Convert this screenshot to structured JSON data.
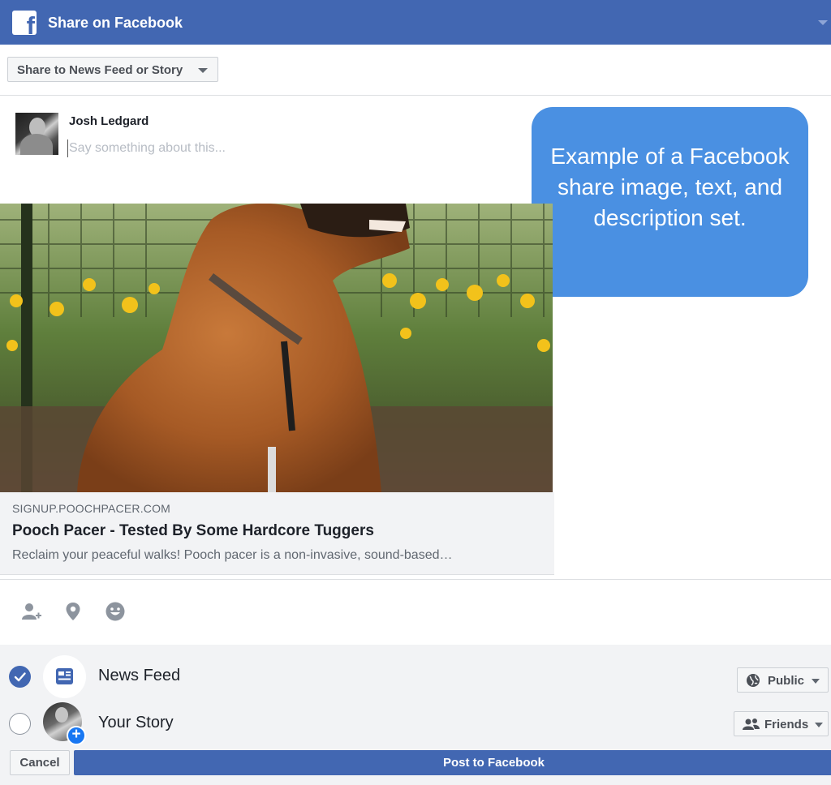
{
  "header": {
    "title": "Share on Facebook",
    "logo_icon": "facebook-f-icon",
    "menu_icon": "chevron-down-icon"
  },
  "share_target": {
    "label": "Share to News Feed or Story",
    "icon": "caret-down-icon"
  },
  "composer": {
    "user_name": "Josh Ledgard",
    "placeholder": "Say something about this...",
    "value": ""
  },
  "callout": {
    "text": "Example of a Facebook share image, text, and description set."
  },
  "link_preview": {
    "domain": "SIGNUP.POOCHPACER.COM",
    "title": "Pooch Pacer - Tested By Some Hardcore Tuggers",
    "description": "Reclaim your peaceful walks! Pooch pacer is a non-invasive, sound-based…"
  },
  "actions": [
    {
      "name": "tag-friends-icon"
    },
    {
      "name": "location-pin-icon"
    },
    {
      "name": "feeling-emoji-icon"
    }
  ],
  "destinations": {
    "news_feed": {
      "label": "News Feed",
      "checked": true,
      "privacy": "Public",
      "privacy_icon": "globe-icon"
    },
    "your_story": {
      "label": "Your Story",
      "checked": false,
      "privacy": "Friends",
      "privacy_icon": "friends-icon"
    }
  },
  "footer": {
    "cancel_label": "Cancel",
    "post_label": "Post to Facebook"
  },
  "colors": {
    "brand": "#4267b2",
    "callout": "#4a90e2",
    "panel": "#f2f3f5"
  }
}
